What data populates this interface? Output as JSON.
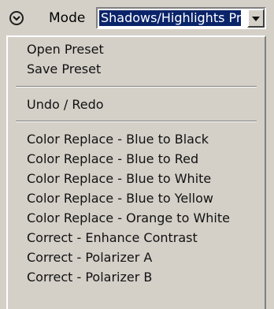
{
  "toolbar": {
    "mode_label": "Mode",
    "mode_value": "Shadows/Highlights Pre"
  },
  "icons": {
    "left_control": "chevron-down-circle-icon",
    "dropdown": "chevron-down-icon"
  },
  "menu": {
    "items": [
      {
        "label": "Open Preset"
      },
      {
        "label": "Save Preset"
      },
      {
        "label": "Undo / Redo"
      },
      {
        "label": "Color Replace - Blue to Black"
      },
      {
        "label": "Color Replace - Blue to Red"
      },
      {
        "label": "Color Replace - Blue to White"
      },
      {
        "label": "Color Replace - Blue to Yellow"
      },
      {
        "label": "Color Replace - Orange to White"
      },
      {
        "label": "Correct - Enhance Contrast"
      },
      {
        "label": "Correct - Polarizer A"
      },
      {
        "label": "Correct - Polarizer B"
      }
    ]
  },
  "colors": {
    "selection": "#0a246a",
    "surface": "#d4d0c8"
  }
}
